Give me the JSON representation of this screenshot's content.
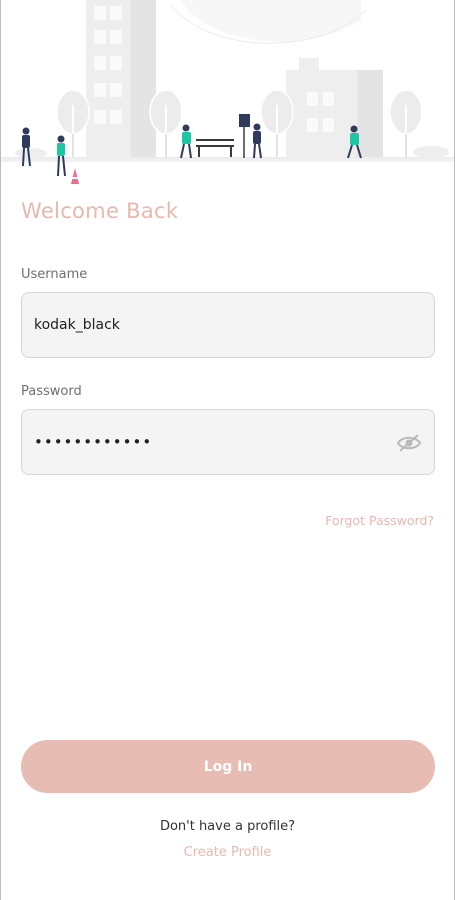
{
  "header": {
    "title": "Welcome Back"
  },
  "form": {
    "username_label": "Username",
    "username_value": "kodak_black",
    "password_label": "Password",
    "password_value": "••••••••••••",
    "forgot_password": "Forgot Password?"
  },
  "actions": {
    "login_label": "Log In",
    "signup_prompt": "Don't have a profile?",
    "create_profile": "Create Profile"
  },
  "colors": {
    "accent": "#e8b8ae",
    "button": "#e6bcb3",
    "field_bg": "#f4f4f4",
    "person_teal": "#1cc7a6",
    "person_navy": "#2f3b5c",
    "cone_pink": "#f26a8d"
  },
  "icons": {
    "password_toggle": "eye-off-icon"
  }
}
